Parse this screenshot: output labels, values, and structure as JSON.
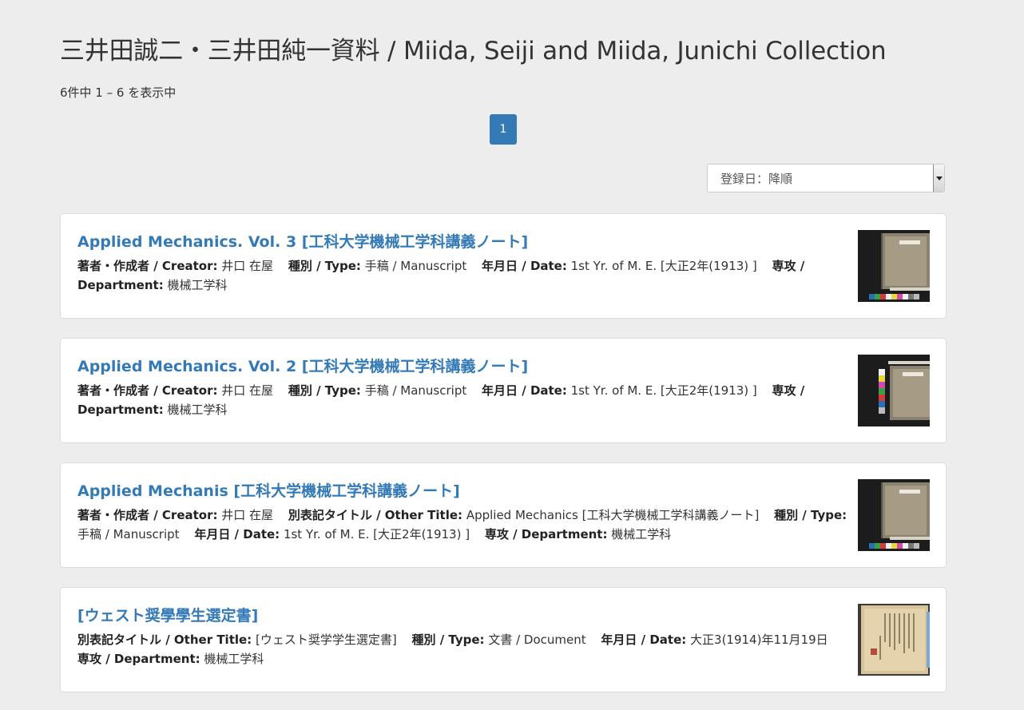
{
  "page": {
    "title": "三井田誠二・三井田純一資料 / Miida, Seiji and Miida, Junichi Collection",
    "result_count": "6件中 1 – 6 を表示中",
    "pagination": {
      "current": "1"
    },
    "sort": {
      "selected": "登録日：降順"
    }
  },
  "results": [
    {
      "title": "Applied Mechanics. Vol. 3 [工科大学機械工学科講義ノート]",
      "f1_label": "著者・作成者 / Creator:",
      "f1_value": "井口 在屋",
      "f2_label": "種別 / Type:",
      "f2_value": "手稿 / Manuscript",
      "f3_label": "年月日 / Date:",
      "f3_value": "1st Yr. of M. E. [大正2年(1913) ]",
      "f4_label": "専攻 / Department:",
      "f4_value": "機械工学科",
      "thumb_icon": "notebook-cover-thumbnail"
    },
    {
      "title": "Applied Mechanics. Vol. 2 [工科大学機械工学科講義ノート]",
      "f1_label": "著者・作成者 / Creator:",
      "f1_value": "井口 在屋",
      "f2_label": "種別 / Type:",
      "f2_value": "手稿 / Manuscript",
      "f3_label": "年月日 / Date:",
      "f3_value": "1st Yr. of M. E. [大正2年(1913) ]",
      "f4_label": "専攻 / Department:",
      "f4_value": "機械工学科",
      "thumb_icon": "notebook-cover-thumbnail"
    },
    {
      "title": "Applied Mechanis [工科大学機械工学科講義ノート]",
      "f1_label": "著者・作成者 / Creator:",
      "f1_value": "井口 在屋",
      "f2_label": "別表記タイトル / Other Title:",
      "f2_value": "Applied Mechanics [工科大学機械工学科講義ノート]",
      "f3_label": "種別 / Type:",
      "f3_value": "手稿 / Manuscript",
      "f4_label": "年月日 / Date:",
      "f4_value": "1st Yr. of M. E. [大正2年(1913) ]",
      "f5_label": "専攻 / Department:",
      "f5_value": "機械工学科",
      "thumb_icon": "notebook-cover-thumbnail"
    },
    {
      "title": "[ウェスト奨學學生選定書]",
      "f1_label": "別表記タイトル / Other Title:",
      "f1_value": "[ウェスト奨学学生選定書]",
      "f2_label": "種別 / Type:",
      "f2_value": "文書 / Document",
      "f3_label": "年月日 / Date:",
      "f3_value": "大正3(1914)年11月19日",
      "f4_label": "専攻 / Department:",
      "f4_value": "機械工学科",
      "thumb_icon": "document-scan-thumbnail"
    }
  ]
}
